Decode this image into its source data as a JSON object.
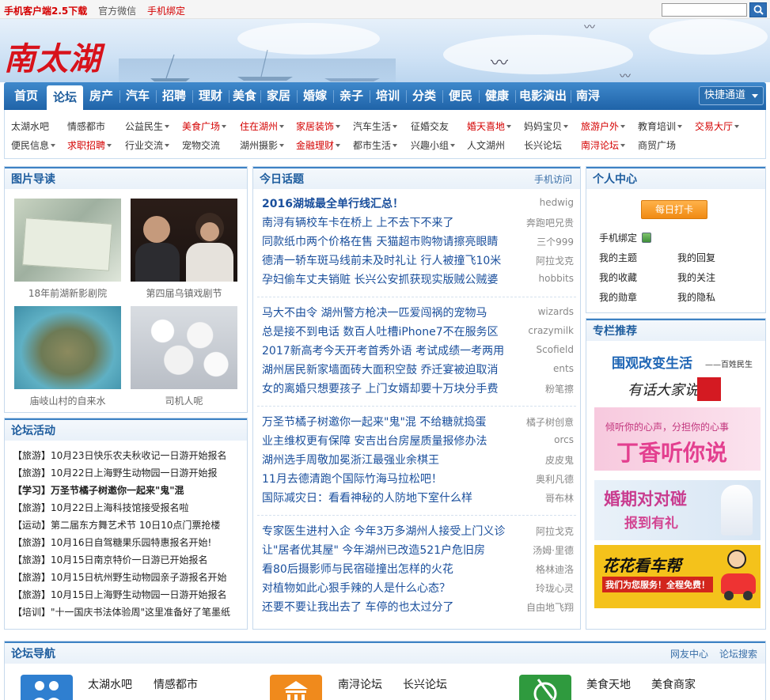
{
  "topbar": {
    "client": "手机客户端2.5下载",
    "wechat": "官方微信",
    "bind": "手机绑定",
    "search_placeholder": ""
  },
  "logo": "南太湖",
  "nav": {
    "items": [
      "首页",
      "论坛",
      "房产",
      "汽车",
      "招聘",
      "理财",
      "美食",
      "家居",
      "婚嫁",
      "亲子",
      "培训",
      "分类",
      "便民",
      "健康",
      "电影演出",
      "南浔"
    ],
    "active": "论坛",
    "quick": "快捷通道"
  },
  "subnav": {
    "row1": [
      {
        "label": "太湖水吧",
        "red": false,
        "dd": false
      },
      {
        "label": "情感都市",
        "red": false,
        "dd": false
      },
      {
        "label": "公益民生",
        "red": false,
        "dd": true
      },
      {
        "label": "美食广场",
        "red": true,
        "dd": true
      },
      {
        "label": "住在湖州",
        "red": true,
        "dd": true
      },
      {
        "label": "家居装饰",
        "red": true,
        "dd": true
      },
      {
        "label": "汽车生活",
        "red": false,
        "dd": true
      },
      {
        "label": "征婚交友",
        "red": false,
        "dd": false
      },
      {
        "label": "婚天喜地",
        "red": true,
        "dd": true
      },
      {
        "label": "妈妈宝贝",
        "red": false,
        "dd": true
      },
      {
        "label": "旅游户外",
        "red": true,
        "dd": true
      },
      {
        "label": "教育培训",
        "red": false,
        "dd": true
      },
      {
        "label": "交易大厅",
        "red": true,
        "dd": true
      }
    ],
    "row2": [
      {
        "label": "便民信息",
        "red": false,
        "dd": true
      },
      {
        "label": "求职招聘",
        "red": true,
        "dd": true
      },
      {
        "label": "行业交流",
        "red": false,
        "dd": true
      },
      {
        "label": "宠物交流",
        "red": false,
        "dd": false
      },
      {
        "label": "湖州摄影",
        "red": false,
        "dd": true
      },
      {
        "label": "金融理财",
        "red": true,
        "dd": true
      },
      {
        "label": "都市生活",
        "red": false,
        "dd": true
      },
      {
        "label": "兴趣小组",
        "red": false,
        "dd": true
      },
      {
        "label": "人文湖州",
        "red": false,
        "dd": false
      },
      {
        "label": "长兴论坛",
        "red": false,
        "dd": false
      },
      {
        "label": "南浔论坛",
        "red": true,
        "dd": true
      },
      {
        "label": "商贸广场",
        "red": false,
        "dd": false
      }
    ]
  },
  "pictures": {
    "title": "图片导读",
    "items": [
      {
        "caption": "18年前湖新影剧院"
      },
      {
        "caption": "第四届乌镇戏剧节"
      },
      {
        "caption": "庙岐山村的自来水"
      },
      {
        "caption": "司机人呢"
      }
    ]
  },
  "activities": {
    "title": "论坛活动",
    "items": [
      {
        "text": "【旅游】10月23日快乐农夫秋收记一日游开始报名",
        "bold": false
      },
      {
        "text": "【旅游】10月22日上海野生动物园一日游开始报",
        "bold": false
      },
      {
        "text": "【学习】万圣节橘子树邀你一起来\"鬼\"混",
        "bold": true
      },
      {
        "text": "【旅游】10月22日上海科技馆接受报名啦",
        "bold": false
      },
      {
        "text": "【运动】第二届东方舞艺术节 10日10点门票抢楼",
        "bold": false
      },
      {
        "text": "【旅游】10月16日自驾糖果乐园特惠报名开始!",
        "bold": false
      },
      {
        "text": "【旅游】10月15日南京特价一日游已开始报名",
        "bold": false
      },
      {
        "text": "【旅游】10月15日杭州野生动物园亲子游报名开始",
        "bold": false
      },
      {
        "text": "【旅游】10月15日上海野生动物园一日游开始报名",
        "bold": false
      },
      {
        "text": "【培训】\"十一国庆书法体验周\"这里准备好了笔墨纸",
        "bold": false
      }
    ]
  },
  "topics": {
    "title": "今日话题",
    "mobile": "手机访问",
    "groups": [
      [
        {
          "t": "2016湖城最全单行线汇总！",
          "u": "hedwig",
          "bold": true
        },
        {
          "t": "南浔有辆校车卡在桥上 上不去下不来了",
          "u": "奔跑吧兄贵",
          "bold": false
        },
        {
          "t": "同款纸巾两个价格在售 天猫超市购物请擦亮眼睛",
          "u": "三个999",
          "bold": false
        },
        {
          "t": "德清一轿车斑马线前未及时礼让 行人被撞飞10米",
          "u": "阿拉戈克",
          "bold": false
        },
        {
          "t": "孕妇偷车丈夫销赃 长兴公安抓获现实版贼公贼婆",
          "u": "hobbits",
          "bold": false
        }
      ],
      [
        {
          "t": "马大不由令 湖州警方枪决一匹爱闯祸的宠物马",
          "u": "wizards",
          "bold": false
        },
        {
          "t": "总是接不到电话 数百人吐槽iPhone7不在服务区",
          "u": "crazymilk",
          "bold": false
        },
        {
          "t": "2017新高考今天开考首秀外语 考试成绩一考两用",
          "u": "Scofield",
          "bold": false
        },
        {
          "t": "湖州居民新家墙面砖大面积空鼓 乔迁宴被迫取消",
          "u": "ents",
          "bold": false
        },
        {
          "t": "女的离婚只想要孩子 上门女婿却要十万块分手费",
          "u": "粉笔擦",
          "bold": false
        }
      ],
      [
        {
          "t": "万圣节橘子树邀你一起来\"鬼\"混 不给糖就捣蛋",
          "u": "橘子树创意",
          "bold": false
        },
        {
          "t": "业主维权更有保障 安吉出台房屋质量报修办法",
          "u": "orcs",
          "bold": false
        },
        {
          "t": "湖州选手周敬加冕浙江最强业余棋王",
          "u": "皮皮鬼",
          "bold": false
        },
        {
          "t": "11月去德清跑个国际竹海马拉松吧！",
          "u": "奥利凡德",
          "bold": false
        },
        {
          "t": "国际减灾日：看看神秘的人防地下室什么样",
          "u": "哥布林",
          "bold": false
        }
      ],
      [
        {
          "t": "专家医生进村入企 今年3万多湖州人接受上门义诊",
          "u": "阿拉戈克",
          "bold": false
        },
        {
          "t": "让\"居者优其屋\" 今年湖州已改造521户危旧房",
          "u": "汤姆·里德",
          "bold": false
        },
        {
          "t": "看80后摄影师与民宿碰撞出怎样的火花",
          "u": "格林迪洛",
          "bold": false
        },
        {
          "t": "对植物如此心狠手辣的人是什么心态？",
          "u": "玲珑心灵",
          "bold": false
        },
        {
          "t": "还要不要让我出去了 车停的也太过分了",
          "u": "自由地飞翔",
          "bold": false
        }
      ]
    ]
  },
  "personal": {
    "title": "个人中心",
    "checkin": "每日打卡",
    "bind": "手机绑定",
    "items": [
      "我的主题",
      "我的回复",
      "我的收藏",
      "我的关注",
      "我的勋章",
      "我的隐私"
    ]
  },
  "column": {
    "title": "专栏推荐",
    "ad1_title": "围观改变生活",
    "ad1_sub": "——百姓民生",
    "ad1_brand": "有话大家说",
    "ad2_line1": "倾听你的心声，分担你的心事",
    "ad2_line2": "丁香听你说",
    "ad3_line1": "婚期对对碰",
    "ad3_line2": "报到有礼",
    "ad4_line1": "花花看车帮",
    "ad4_line2": "我们为您服务！全程免费！",
    "colors": {
      "ad2": "#e33f8f",
      "ad3": "#c93c8f",
      "ad4": "#f4c21b"
    }
  },
  "bottom_nav": {
    "title": "论坛导航",
    "friends": "网友中心",
    "search": "论坛搜索",
    "group1": [
      "太湖水吧",
      "情感都市"
    ],
    "group2": [
      "南浔论坛",
      "长兴论坛"
    ],
    "group3": [
      "美食天地",
      "美食商家"
    ],
    "icons": {
      "group1": "people-icon",
      "group2": "building-icon",
      "group3": "food-icon"
    }
  }
}
